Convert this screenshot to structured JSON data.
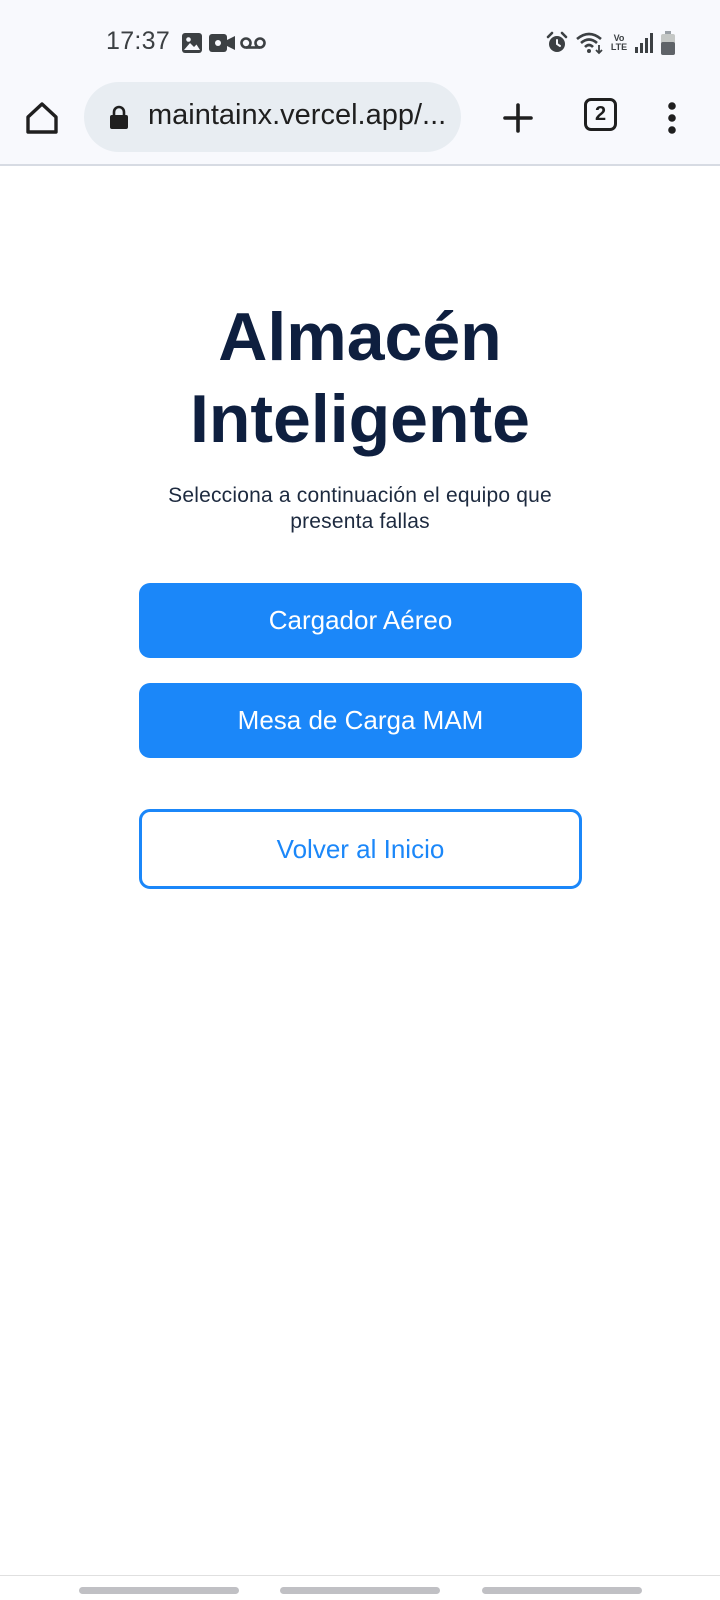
{
  "status_bar": {
    "time": "17:37",
    "left_icons": [
      "image-icon",
      "video-icon",
      "voicemail-icon"
    ],
    "right_icons": [
      "alarm-icon",
      "wifi-icon",
      "volte-icon",
      "signal-icon",
      "battery-icon"
    ],
    "volte_line1": "Vo",
    "volte_line2": "LTE"
  },
  "browser": {
    "url": "maintainx.vercel.app/...",
    "tab_count": "2"
  },
  "page": {
    "title_line1": "Almacén",
    "title_line2": "Inteligente",
    "subtitle_line1": "Selecciona a continuación el equipo que",
    "subtitle_line2": "presenta fallas",
    "buttons": {
      "cargador": "Cargador Aéreo",
      "mesa": "Mesa de Carga MAM",
      "volver": "Volver al Inicio"
    }
  },
  "colors": {
    "primary": "#1b87f9",
    "title": "#0e1f3f",
    "chrome_bg": "#f8f9fd",
    "url_pill": "#e8edf2"
  }
}
